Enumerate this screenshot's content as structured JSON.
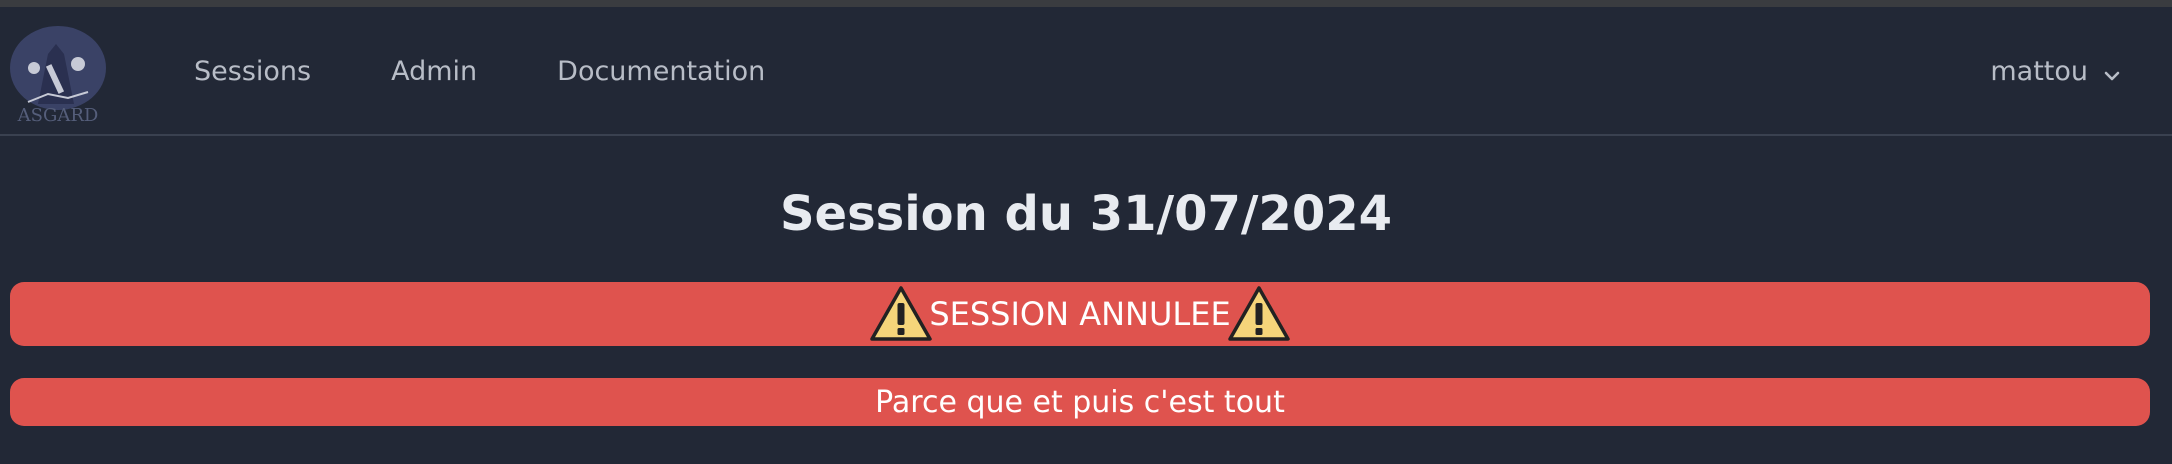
{
  "header": {
    "logo_text": "ASGARD",
    "nav": [
      {
        "label": "Sessions"
      },
      {
        "label": "Admin"
      },
      {
        "label": "Documentation"
      }
    ],
    "user": {
      "name": "mattou",
      "icon": "chevron-down-icon"
    }
  },
  "page": {
    "title": "Session du 31/07/2024",
    "cancel_banner": {
      "text": "SESSION ANNULEE",
      "icon": "warning-icon",
      "color": "#df534e"
    },
    "reason": "Parce que et puis c'est tout"
  },
  "colors": {
    "background": "#222836",
    "text": "#e6e9ef",
    "nav_text": "#b8bdc7",
    "alert": "#df534e"
  }
}
